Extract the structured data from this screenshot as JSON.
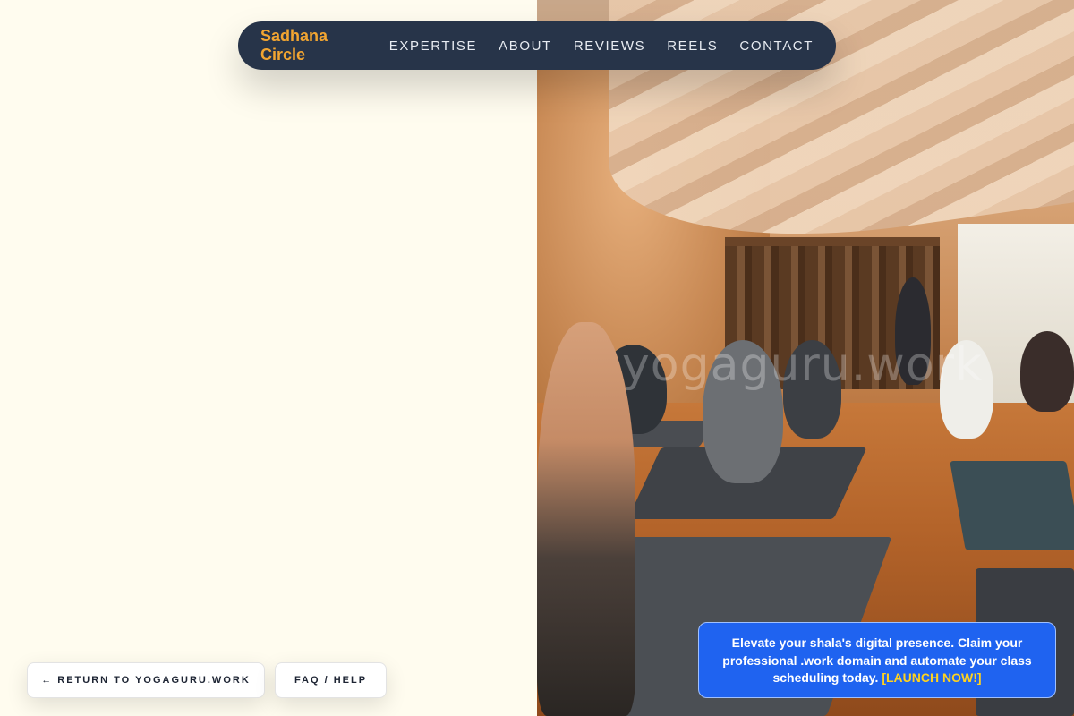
{
  "nav": {
    "brand": "Sadhana Circle",
    "links": [
      "EXPERTISE",
      "ABOUT",
      "REVIEWS",
      "REELS",
      "CONTACT"
    ]
  },
  "hero": {
    "image_alt": "Yoga class in a warm studio",
    "watermark": "yogaguru.work"
  },
  "footer_buttons": {
    "return_label": "← RETURN TO YOGAGURU.WORK",
    "faq_label": "FAQ / HELP"
  },
  "promo": {
    "text": "Elevate your shala's digital presence. Claim your professional .work domain and automate your class scheduling today. ",
    "cta": "[LAUNCH NOW!]"
  },
  "colors": {
    "page_background": "#fffcef",
    "nav_background": "#273449",
    "brand_accent": "#f2a531",
    "promo_background": "#1f63f0",
    "promo_cta": "#ffd21f"
  }
}
